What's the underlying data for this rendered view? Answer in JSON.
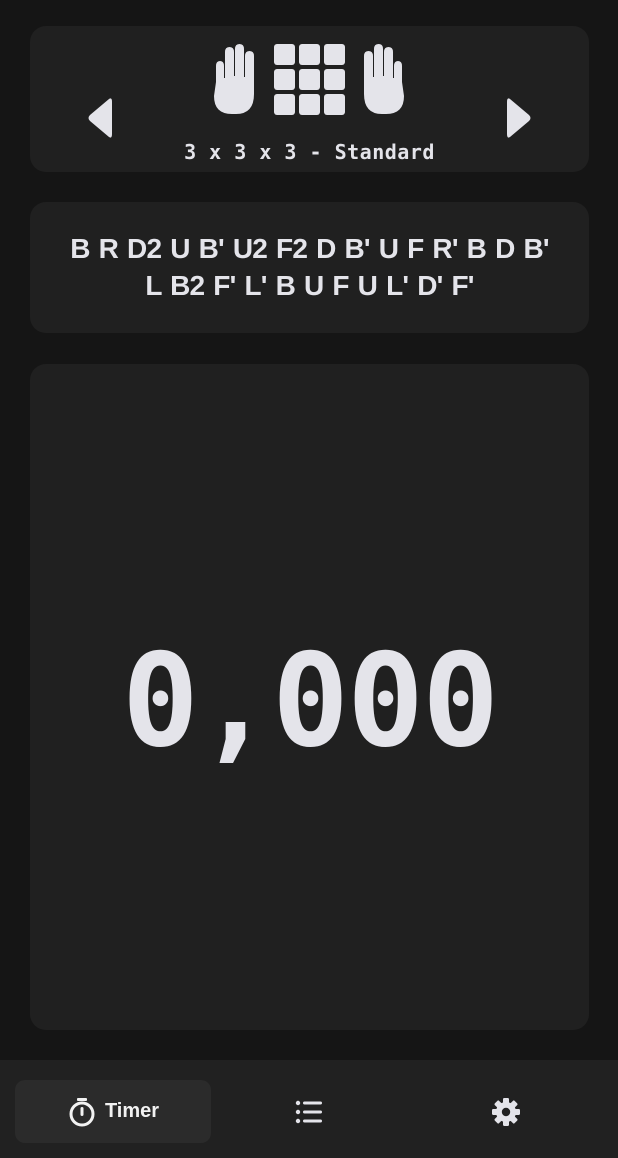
{
  "puzzle": {
    "name": "3 x 3 x 3 - Standard",
    "prev_icon": "caret-left-icon",
    "next_icon": "caret-right-icon",
    "left_hand_icon": "hand-icon",
    "cube_icon": "cube-grid-icon",
    "right_hand_icon": "hand-icon"
  },
  "scramble": {
    "text": "B R D2 U B' U2 F2 D B' U F R' B D B' L B2 F' L' B U F U L' D' F'"
  },
  "timer": {
    "value": "0,000"
  },
  "nav": {
    "items": [
      {
        "label": "Timer",
        "icon": "stopwatch-icon",
        "active": true
      },
      {
        "label": "",
        "icon": "list-icon",
        "active": false
      },
      {
        "label": "",
        "icon": "gear-icon",
        "active": false
      }
    ]
  },
  "colors": {
    "background": "#151515",
    "card": "#202020",
    "foreground": "#e4e4ea",
    "nav_bar": "#212121",
    "nav_active": "#2b2b2b"
  }
}
